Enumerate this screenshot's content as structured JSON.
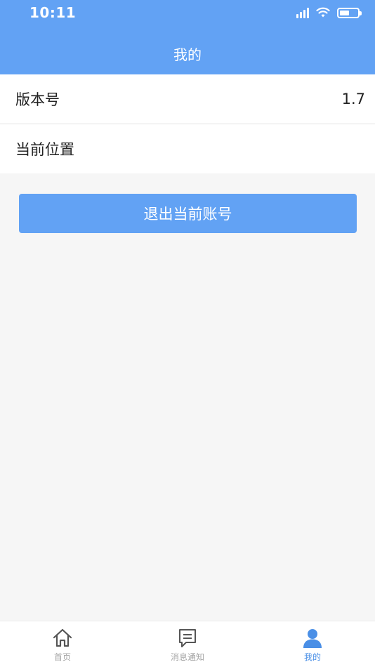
{
  "status_bar": {
    "time": "10:11",
    "icons": [
      "signal-icon",
      "wifi-icon",
      "battery-icon"
    ],
    "battery_level": 0.55
  },
  "header": {
    "title": "我的"
  },
  "settings": {
    "items": [
      {
        "label": "版本号",
        "value": "1.7"
      },
      {
        "label": "当前位置",
        "value": ""
      }
    ]
  },
  "actions": {
    "logout_label": "退出当前账号"
  },
  "tabbar": {
    "tabs": [
      {
        "label": "首页",
        "icon": "home-icon",
        "active": false
      },
      {
        "label": "消息通知",
        "icon": "message-icon",
        "active": false
      },
      {
        "label": "我的",
        "icon": "user-icon",
        "active": true
      }
    ]
  },
  "colors": {
    "accent": "#62a2f4",
    "tab_active": "#4a8fe6",
    "tab_inactive": "#a5a5a5",
    "background": "#f6f6f6"
  }
}
